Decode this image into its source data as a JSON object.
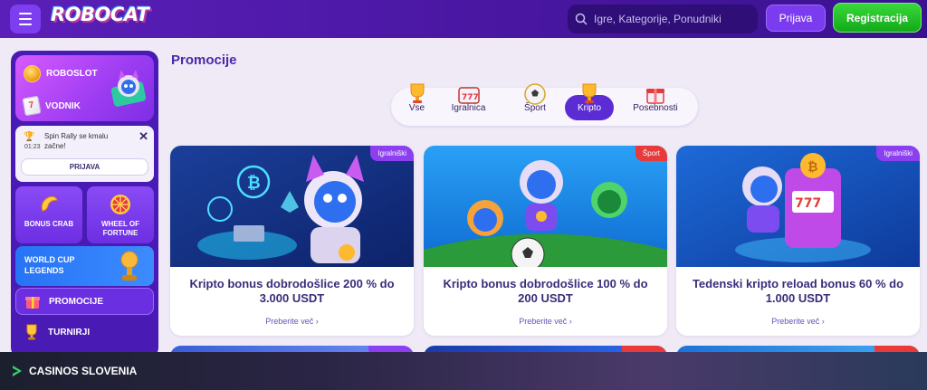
{
  "header": {
    "logo_text": "ROBOCAT",
    "search_placeholder": "Igre, Kategorije, Ponudniki",
    "login_label": "Prijava",
    "register_label": "Registracija"
  },
  "sidebar": {
    "promo": [
      {
        "label": "ROBOSLOT",
        "icon": "coin-icon"
      },
      {
        "label": "VODNIK",
        "icon": "guide-book-icon"
      }
    ],
    "spin_rally": {
      "text": "Spin Rally se kmalu začne!",
      "time": "01:23",
      "button_label": "PRIJAVA"
    },
    "tiles": [
      {
        "label": "BONUS CRAB",
        "icon": "bonus-crab-icon"
      },
      {
        "label": "WHEEL OF FORTUNE",
        "icon": "wheel-icon"
      }
    ],
    "worldcup_label": "WORLD CUP LEGENDS",
    "nav": [
      {
        "label": "PROMOCIJE",
        "icon": "gift-icon"
      },
      {
        "label": "TURNIRJI",
        "icon": "trophy-icon"
      }
    ]
  },
  "main": {
    "title": "Promocije",
    "tabs": [
      {
        "label": "Vse",
        "active": false
      },
      {
        "label": "Igralnica",
        "active": false
      },
      {
        "label": "Šport",
        "active": false
      },
      {
        "label": "Kripto",
        "active": true
      },
      {
        "label": "Posebnosti",
        "active": false
      }
    ],
    "cards": [
      {
        "badge": "Igralniški",
        "title": "Kripto bonus dobrodošlice 200 % do 3.000 USDT",
        "link": "Preberite več"
      },
      {
        "badge": "Šport",
        "title": "Kripto bonus dobrodošlice 100 % do 200 USDT",
        "link": "Preberite več"
      },
      {
        "badge": "Igralniški",
        "title": "Tedenski kripto reload bonus 60 % do 1.000 USDT",
        "link": "Preberite več"
      }
    ]
  },
  "footer": {
    "brand": "CASINOS SLOVENIA"
  },
  "colors": {
    "header": "#4a17a3",
    "accent": "#5b2bd4",
    "register": "#13a81a",
    "badge_purple": "#8c3ff0",
    "badge_red": "#e83a3a"
  }
}
